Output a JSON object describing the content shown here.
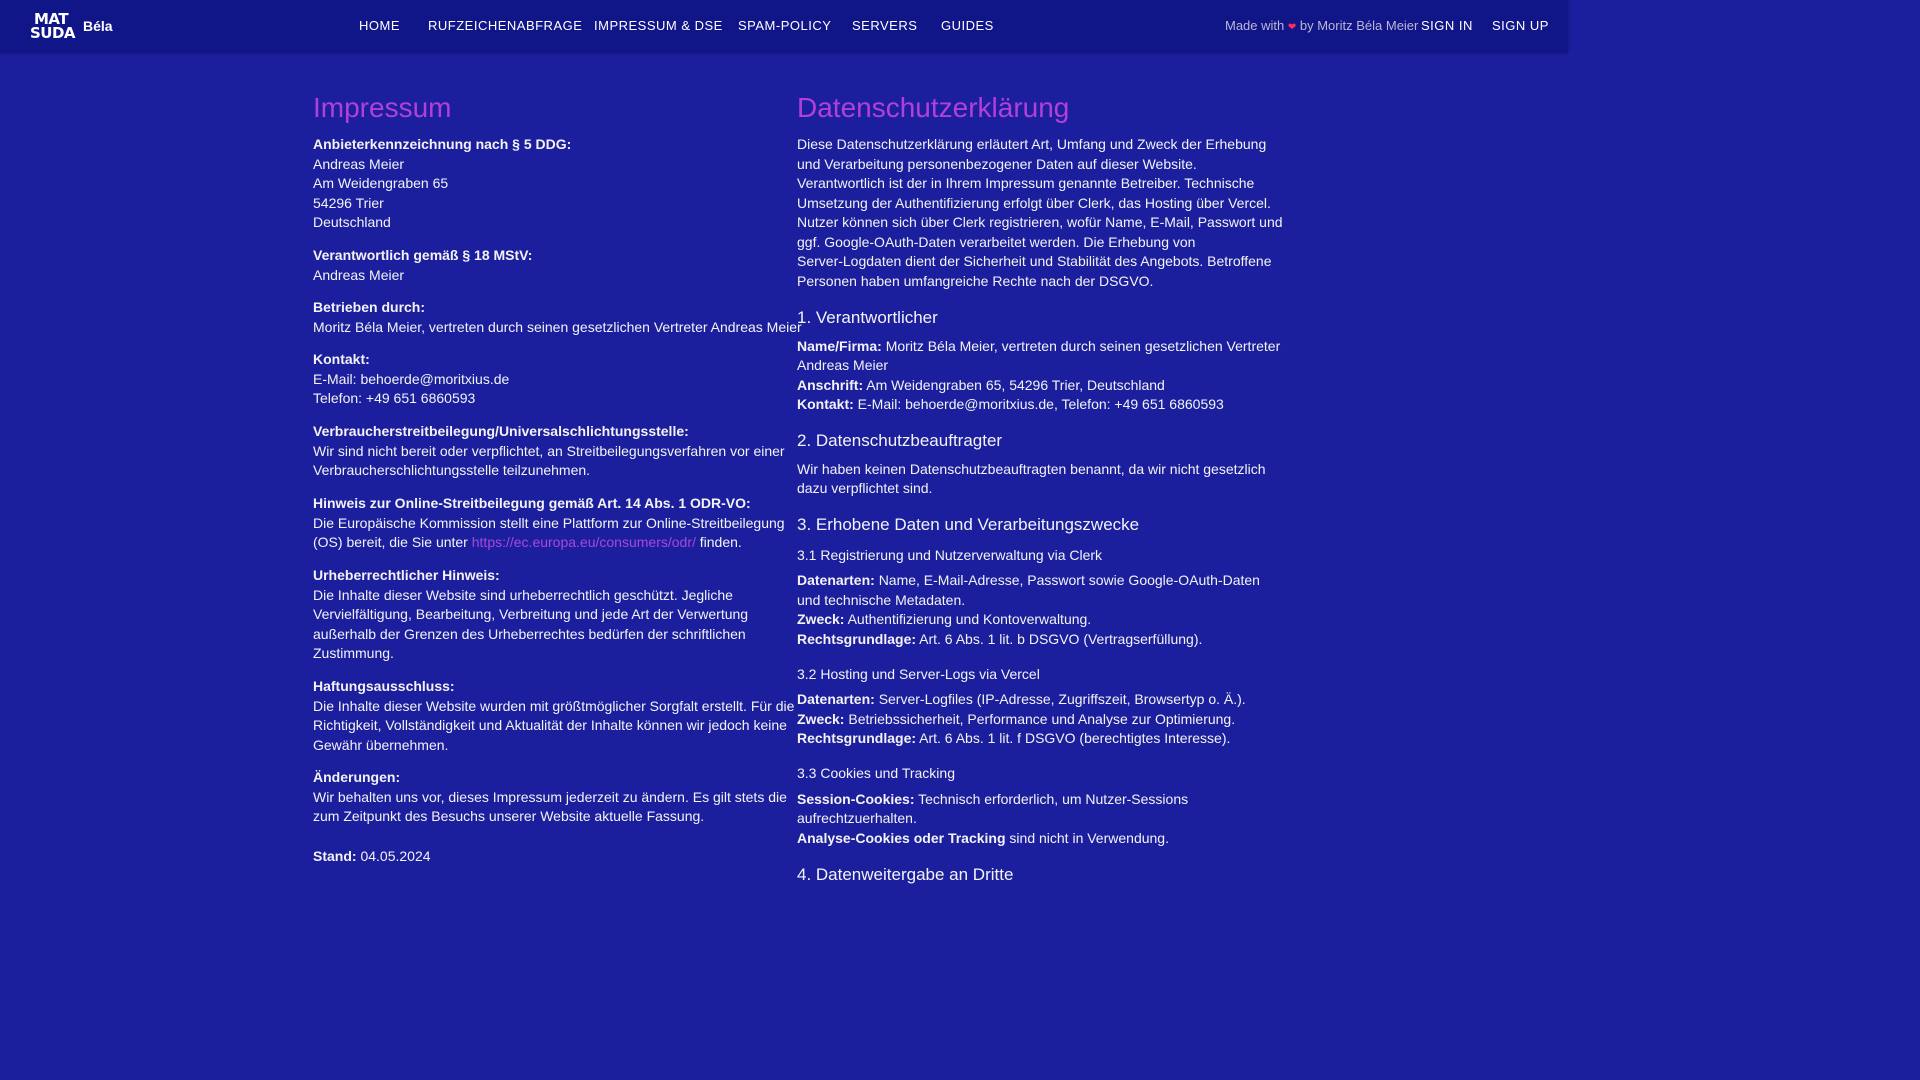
{
  "nav": {
    "logo_mark_line1": "MAT",
    "logo_mark_line2": "SUDA",
    "logo_text": "Béla",
    "links": [
      "HOME",
      "RUFZEICHENABFRAGE",
      "IMPRESSUM & DSE",
      "SPAM-POLICY",
      "SERVERS",
      "GUIDES"
    ],
    "made_prefix": "Made with",
    "made_heart": "❤",
    "made_suffix": "by Moritz Béla Meier",
    "sign_in": "SIGN IN",
    "sign_up": "SIGN UP"
  },
  "impressum": {
    "title": "Impressum",
    "anbieter_heading": "Anbieterkennzeichnung nach § 5 DDG:",
    "anbieter_lines": [
      "Andreas Meier",
      "Am Weidengraben 65",
      "54296 Trier",
      "Deutschland"
    ],
    "verantwortlich_heading": "Verantwortlich gemäß § 18 MStV:",
    "verantwortlich_name": "Andreas Meier",
    "betrieben_heading": "Betrieben durch:",
    "betrieben_text": "Moritz Béla Meier, vertreten durch seinen gesetzlichen Vertreter Andreas Meier",
    "kontakt_heading": "Kontakt:",
    "kontakt_email": "E-Mail: behoerde@moritxius.de",
    "kontakt_phone": "Telefon: +49 651 6860593",
    "verbraucher_heading": "Verbraucherstreitbeilegung/Universalschlichtungsstelle:",
    "verbraucher_lines": [
      "Wir sind nicht bereit oder verpflichtet, an Streitbeilegungsverfahren vor einer",
      "Verbraucherschlichtungsstelle teilzunehmen."
    ],
    "odr_heading": "Hinweis zur Online-Streitbeilegung gemäß Art. 14 Abs. 1 ODR-VO:",
    "odr_line1": "Die Europäische Kommission stellt eine Plattform zur Online-Streitbeilegung",
    "odr_line2_pre": "(OS) bereit, die Sie unter",
    "odr_link": "https://ec.europa.eu/consumers/odr/",
    "odr_line2_post": "finden.",
    "urheber_heading": "Urheberrechtlicher Hinweis:",
    "urheber_lines": [
      "Die Inhalte dieser Website sind urheberrechtlich geschützt. Jegliche",
      "Vervielfältigung, Bearbeitung, Verbreitung und jede Art der Verwertung",
      "außerhalb der Grenzen des Urheberrechtes bedürfen der schriftlichen",
      "Zustimmung."
    ],
    "haftung_heading": "Haftungsausschluss:",
    "haftung_lines": [
      "Die Inhalte dieser Website wurden mit größtmöglicher Sorgfalt erstellt. Für die",
      "Richtigkeit, Vollständigkeit und Aktualität der Inhalte können wir jedoch keine",
      "Gewähr übernehmen."
    ],
    "aenderungen_heading": "Änderungen:",
    "aenderungen_lines": [
      "Wir behalten uns vor, dieses Impressum jederzeit zu ändern. Es gilt stets die",
      "zum Zeitpunkt des Besuchs unserer Website aktuelle Fassung."
    ],
    "stand_label": "Stand:",
    "stand_value": "04.05.2024"
  },
  "dse": {
    "title": "Datenschutzerklärung",
    "intro_lines": [
      "Diese Datenschutzerklärung erläutert Art, Umfang und Zweck der Erhebung",
      "und Verarbeitung personenbezogener Daten auf dieser Website.",
      "Verantwortlich ist der in Ihrem Impressum genannte Betreiber. Technische",
      "Umsetzung der Authentifizierung erfolgt über Clerk, das Hosting über Vercel.",
      "Nutzer können sich über Clerk registrieren, wofür Name, E-Mail, Passwort und",
      "ggf. Google-OAuth-Daten verarbeitet werden. Die Erhebung von",
      "Server-Logdaten dient der Sicherheit und Stabilität des Angebots. Betroffene",
      "Personen haben umfangreiche Rechte nach der DSGVO."
    ],
    "s1_title": "1. Verantwortlicher",
    "s1_name_label": "Name/Firma:",
    "s1_name_value": "Moritz Béla Meier, vertreten durch seinen gesetzlichen Vertreter",
    "s1_name_value2": "Andreas Meier",
    "s1_addr_label": "Anschrift:",
    "s1_addr_value": "Am Weidengraben 65, 54296 Trier, Deutschland",
    "s1_kontakt_label": "Kontakt:",
    "s1_kontakt_value": "E-Mail: behoerde@moritxius.de, Telefon: +49 651 6860593",
    "s2_title": "2. Datenschutzbeauftragter",
    "s2_lines": [
      "Wir haben keinen Datenschutzbeauftragten benannt, da wir nicht gesetzlich",
      "dazu verpflichtet sind."
    ],
    "s3_title": "3. Erhobene Daten und Verarbeitungszwecke",
    "s31_title": "3.1 Registrierung und Nutzerverwaltung via Clerk",
    "s31_daten_label": "Datenarten:",
    "s31_daten_value": "Name, E-Mail-Adresse, Passwort sowie Google-OAuth-Daten",
    "s31_daten_value2": "und technische Metadaten.",
    "s31_zweck_label": "Zweck:",
    "s31_zweck_value": "Authentifizierung und Kontoverwaltung.",
    "s31_rg_label": "Rechtsgrundlage:",
    "s31_rg_value": "Art. 6 Abs. 1 lit. b DSGVO (Vertragserfüllung).",
    "s32_title": "3.2 Hosting und Server-Logs via Vercel",
    "s32_daten_label": "Datenarten:",
    "s32_daten_value": "Server-Logfiles (IP-Adresse, Zugriffszeit, Browsertyp o. Ä.).",
    "s32_zweck_label": "Zweck:",
    "s32_zweck_value": "Betriebssicherheit, Performance und Analyse zur Optimierung.",
    "s32_rg_label": "Rechtsgrundlage:",
    "s32_rg_value": "Art. 6 Abs. 1 lit. f DSGVO (berechtigtes Interesse).",
    "s33_title": "3.3 Cookies und Tracking",
    "s33_session_label": "Session-Cookies:",
    "s33_session_value": "Technisch erforderlich, um Nutzer-Sessions",
    "s33_session_value2": "aufrechtzuerhalten.",
    "s33_analyse_label": "Analyse-Cookies oder Tracking",
    "s33_analyse_value": "sind nicht in Verwendung.",
    "s4_title": "4. Datenweitergabe an Dritte"
  }
}
